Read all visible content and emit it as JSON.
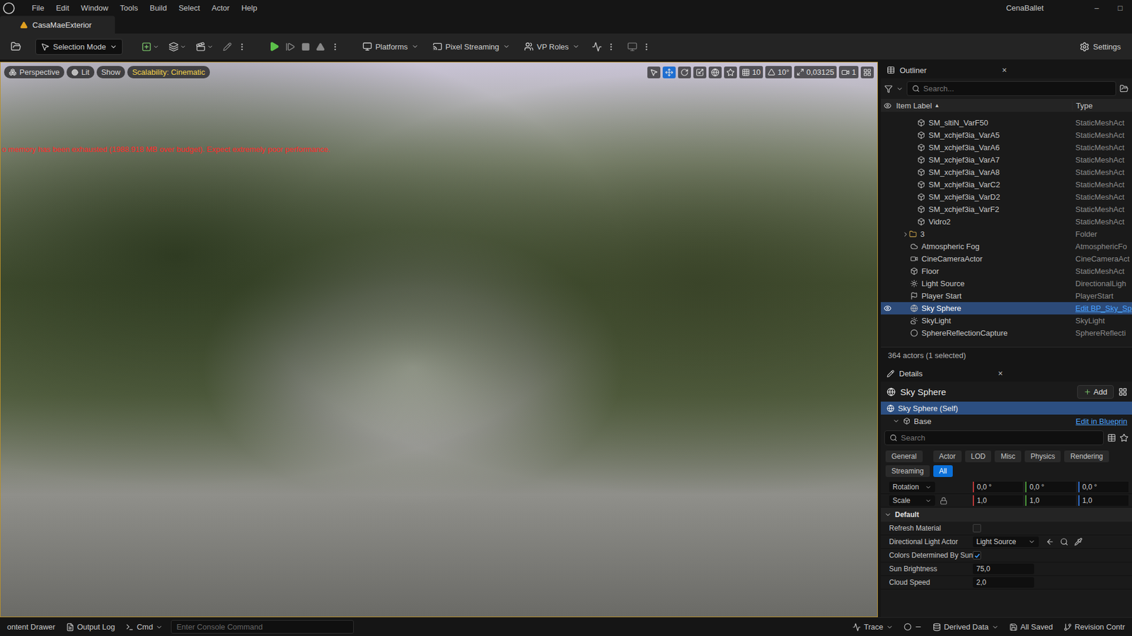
{
  "menu": [
    "File",
    "Edit",
    "Window",
    "Tools",
    "Build",
    "Select",
    "Actor",
    "Help"
  ],
  "app_name": "CenaBallet",
  "window_controls": [
    "–",
    "□"
  ],
  "level_tab": "CasaMaeExterior",
  "toolbar": {
    "mode": "Selection Mode",
    "platforms": "Platforms",
    "pixel_streaming": "Pixel Streaming",
    "vp_roles": "VP Roles",
    "settings": "Settings"
  },
  "viewport": {
    "view": "Perspective",
    "lit": "Lit",
    "show": "Show",
    "scalability": "Scalability: Cinematic",
    "warning": "o memory has been exhausted (1988.918 MB over budget). Expect extremely poor performance.",
    "grid_snap": "10",
    "rotation_snap": "10°",
    "scale_snap": "0,03125",
    "camera_speed": "1"
  },
  "outliner": {
    "title": "Outliner",
    "close": "×",
    "search_placeholder": "Search...",
    "columns": [
      {
        "label": "Item Label",
        "sort": "▲"
      },
      {
        "label": "Type",
        "sort": ""
      }
    ],
    "rows": [
      {
        "label": "SM_sltiN_VarF50",
        "type": "StaticMeshAct",
        "kind": "mesh",
        "selected": false
      },
      {
        "label": "SM_xchjef3ia_VarA5",
        "type": "StaticMeshAct",
        "kind": "mesh",
        "selected": false
      },
      {
        "label": "SM_xchjef3ia_VarA6",
        "type": "StaticMeshAct",
        "kind": "mesh",
        "selected": false
      },
      {
        "label": "SM_xchjef3ia_VarA7",
        "type": "StaticMeshAct",
        "kind": "mesh",
        "selected": false
      },
      {
        "label": "SM_xchjef3ia_VarA8",
        "type": "StaticMeshAct",
        "kind": "mesh",
        "selected": false
      },
      {
        "label": "SM_xchjef3ia_VarC2",
        "type": "StaticMeshAct",
        "kind": "mesh",
        "selected": false
      },
      {
        "label": "SM_xchjef3ia_VarD2",
        "type": "StaticMeshAct",
        "kind": "mesh",
        "selected": false
      },
      {
        "label": "SM_xchjef3ia_VarF2",
        "type": "StaticMeshAct",
        "kind": "mesh",
        "selected": false
      },
      {
        "label": "Vidro2",
        "type": "StaticMeshAct",
        "kind": "mesh",
        "selected": false
      },
      {
        "label": "3",
        "type": "Folder",
        "kind": "folder",
        "selected": false
      },
      {
        "label": "Atmospheric Fog",
        "type": "AtmosphericFo",
        "kind": "fog",
        "selected": false
      },
      {
        "label": "CineCameraActor",
        "type": "CineCameraAct",
        "kind": "camera",
        "selected": false
      },
      {
        "label": "Floor",
        "type": "StaticMeshAct",
        "kind": "actor",
        "selected": false
      },
      {
        "label": "Light Source",
        "type": "DirectionalLigh",
        "kind": "light",
        "selected": false
      },
      {
        "label": "Player Start",
        "type": "PlayerStart",
        "kind": "player",
        "selected": false
      },
      {
        "label": "Sky Sphere",
        "type": "Edit BP_Sky_Sp",
        "kind": "sky",
        "selected": true
      },
      {
        "label": "SkyLight",
        "type": "SkyLight",
        "kind": "skylight",
        "selected": false
      },
      {
        "label": "SphereReflectionCapture",
        "type": "SphereReflecti",
        "kind": "capture",
        "selected": false
      }
    ],
    "footer": "364 actors (1 selected)"
  },
  "details": {
    "title": "Details",
    "close": "×",
    "actor": "Sky Sphere",
    "add": "Add",
    "component": {
      "label": "Sky Sphere (Self)",
      "selected": true
    },
    "base": "Base",
    "edit_blueprint": "Edit in Blueprin",
    "search_placeholder": "Search",
    "filters": [
      {
        "label": "General",
        "selected": false
      },
      {
        "label": "Actor",
        "selected": false
      },
      {
        "label": "LOD",
        "selected": false
      },
      {
        "label": "Misc",
        "selected": false
      },
      {
        "label": "Physics",
        "selected": false
      },
      {
        "label": "Rendering",
        "selected": false
      },
      {
        "label": "Streaming",
        "selected": false
      },
      {
        "label": "All",
        "selected": true
      }
    ],
    "transform": [
      {
        "label": "Rotation",
        "values": [
          "0,0 °",
          "0,0 °",
          "0,0 °"
        ]
      },
      {
        "label": "Scale",
        "values": [
          "1,0",
          "1,0",
          "1,0"
        ],
        "locked": false
      }
    ],
    "section": "Default",
    "properties": [
      {
        "label": "Refresh Material",
        "kind": "checkbox",
        "checked": false
      },
      {
        "label": "Directional Light Actor",
        "kind": "dropdown",
        "value": "Light Source"
      },
      {
        "label": "Colors Determined By Sun...",
        "kind": "checkbox",
        "checked": true
      },
      {
        "label": "Sun Brightness",
        "kind": "number",
        "value": "75,0"
      },
      {
        "label": "Cloud Speed",
        "kind": "number",
        "value": "2,0"
      }
    ]
  },
  "status_bar": {
    "content_drawer": "ontent Drawer",
    "output_log": "Output Log",
    "cmd": "Cmd",
    "console_placeholder": "Enter Console Command",
    "trace": "Trace",
    "derived_data": "Derived Data",
    "saved": "All Saved",
    "revision": "Revision Contr"
  }
}
